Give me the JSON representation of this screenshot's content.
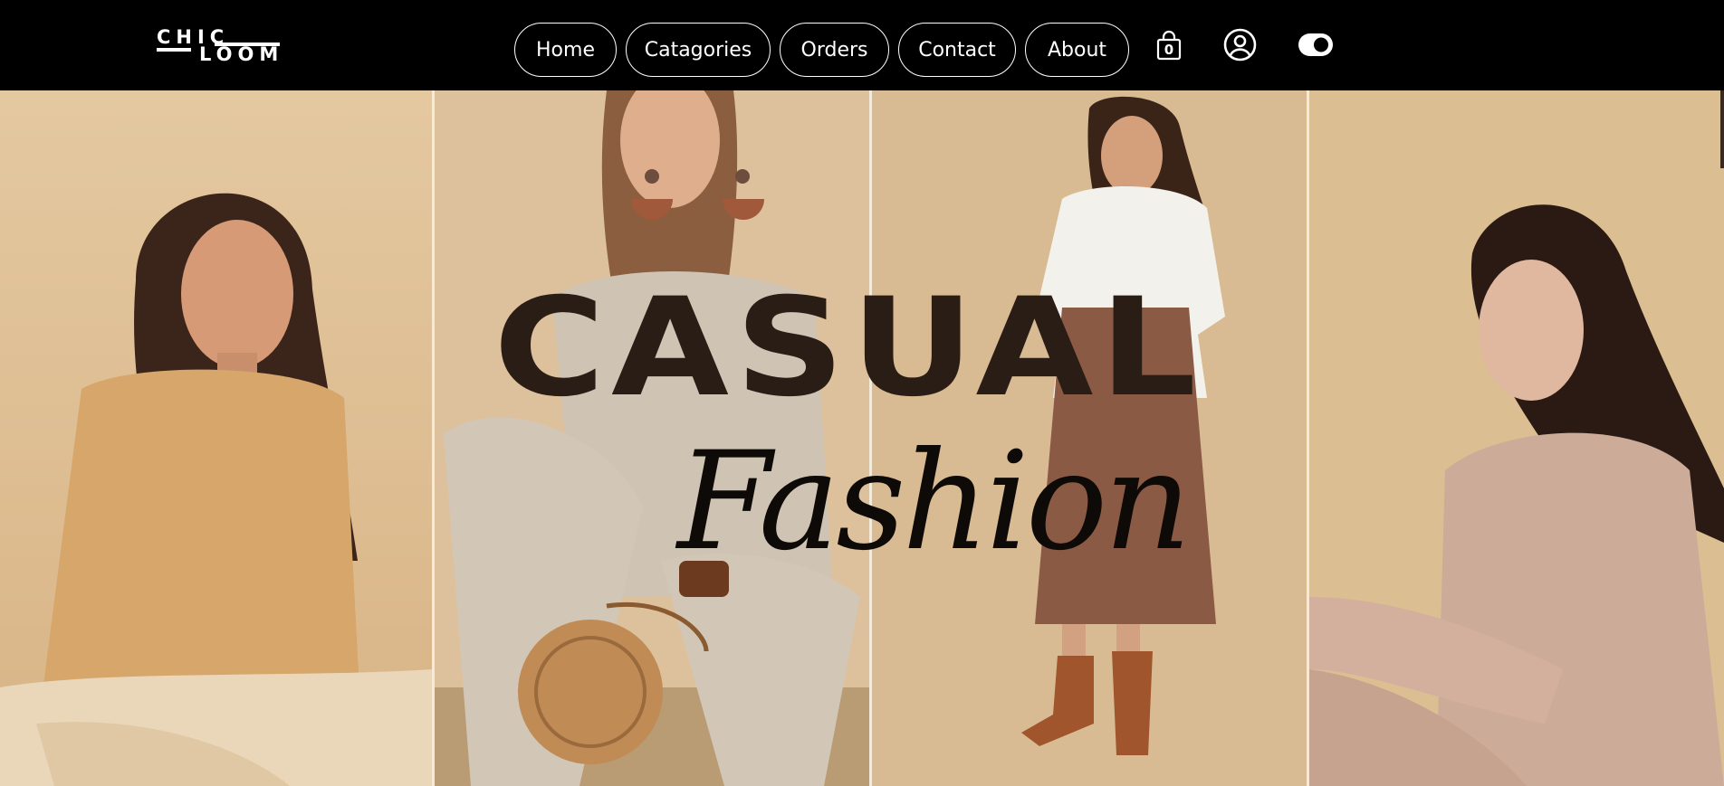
{
  "brand": {
    "logo_line1": "CHIC",
    "logo_line2": "LOOM"
  },
  "nav": {
    "items": [
      {
        "label": "Home"
      },
      {
        "label": "Catagories"
      },
      {
        "label": "Orders"
      },
      {
        "label": "Contact"
      },
      {
        "label": "About"
      }
    ],
    "cart_count": "0",
    "icons": [
      "shopping-bag-icon",
      "user-account-icon",
      "theme-toggle-icon"
    ]
  },
  "hero": {
    "title": "CASUAL",
    "script_text": "Fashion",
    "panels": [
      {
        "subject": "model in tan cardigan"
      },
      {
        "subject": "model in ribbed knit set with rattan bag"
      },
      {
        "subject": "model in white sweater and brown skirt"
      },
      {
        "subject": "model in beige shirt dress"
      }
    ]
  },
  "colors": {
    "nav_background": "#000000",
    "nav_text": "#ffffff",
    "hero_background": "#d9b98e",
    "title_color": "#2a1d15",
    "script_color": "#0e0a07"
  }
}
